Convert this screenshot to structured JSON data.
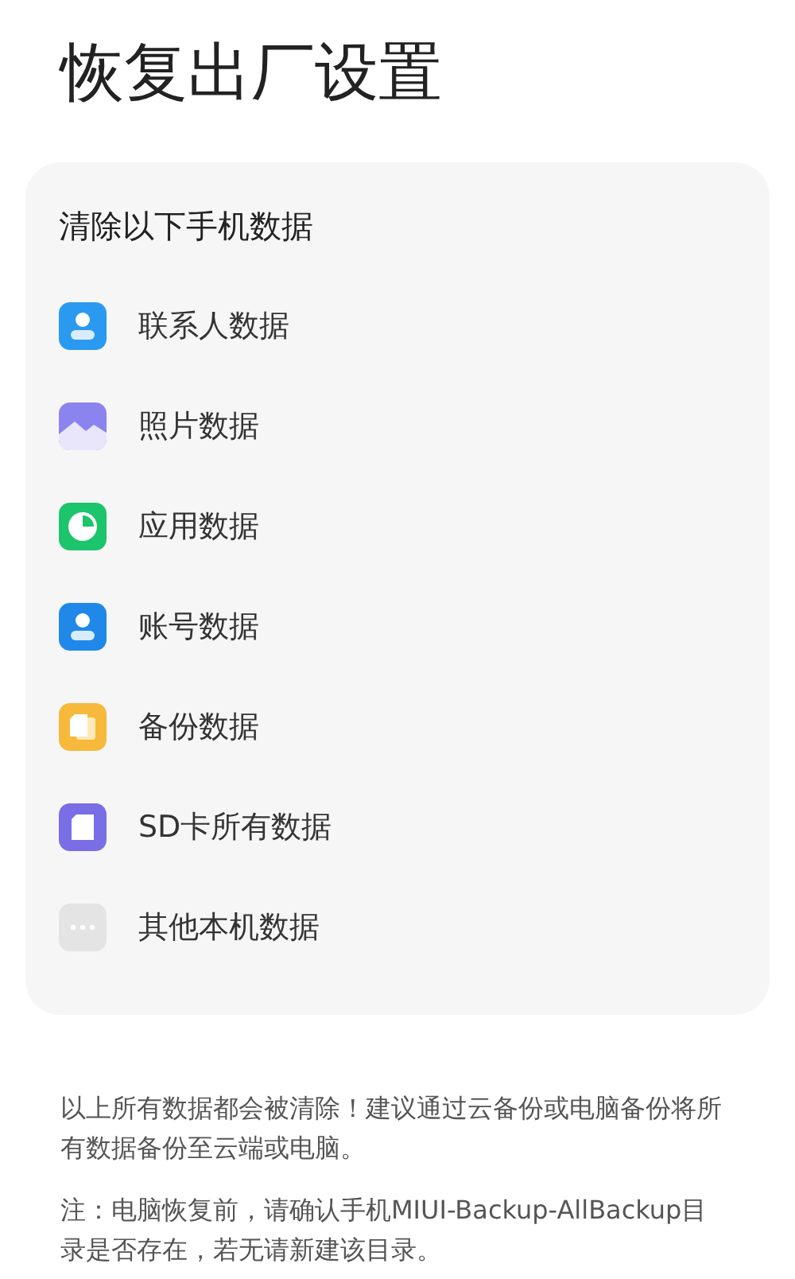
{
  "title": "恢复出厂设置",
  "card": {
    "heading": "清除以下手机数据",
    "items": [
      {
        "label": "联系人数据",
        "kind": "contact"
      },
      {
        "label": "照片数据",
        "kind": "photo"
      },
      {
        "label": "应用数据",
        "kind": "app"
      },
      {
        "label": "账号数据",
        "kind": "account"
      },
      {
        "label": "备份数据",
        "kind": "backup"
      },
      {
        "label": "SD卡所有数据",
        "kind": "sdcard"
      },
      {
        "label": "其他本机数据",
        "kind": "other"
      }
    ]
  },
  "notes": [
    "以上所有数据都会被清除！建议通过云备份或电脑备份将所有数据备份至云端或电脑。",
    "注：电脑恢复前，请确认手机MIUI-Backup-AllBackup目录是否存在，若无请新建该目录。"
  ]
}
